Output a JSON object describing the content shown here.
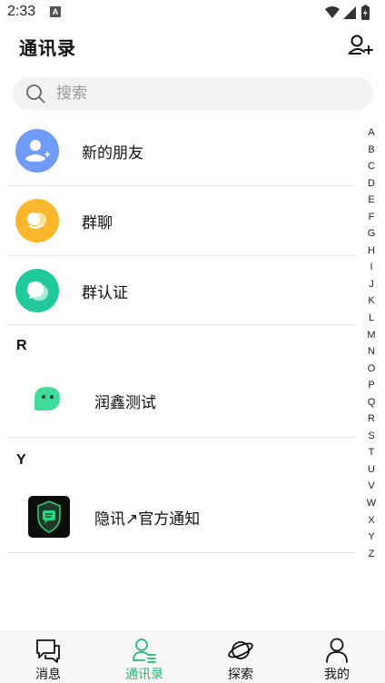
{
  "status_bar": {
    "time": "2:33",
    "notification_badge": "A"
  },
  "header": {
    "title": "通讯录",
    "add_friend_icon": "add-contact-icon"
  },
  "search": {
    "placeholder": "搜索"
  },
  "entries": [
    {
      "label": "新的朋友",
      "icon": "new-friend-icon",
      "color": "#6f9bfb"
    },
    {
      "label": "群聊",
      "icon": "group-chat-icon",
      "color": "#fbb72b"
    },
    {
      "label": "群认证",
      "icon": "group-verify-icon",
      "color": "#22c99a"
    }
  ],
  "sections": [
    {
      "letter": "R",
      "contacts": [
        {
          "name": "润鑫测试",
          "avatar": "green-chat-bubble-avatar",
          "color": "#3fdc9c"
        }
      ]
    },
    {
      "letter": "Y",
      "contacts": [
        {
          "name": "隐讯↗官方通知",
          "avatar": "shield-avatar",
          "color": "#1a1a1a"
        }
      ]
    }
  ],
  "index_letters": [
    "A",
    "B",
    "C",
    "D",
    "E",
    "F",
    "G",
    "H",
    "I",
    "J",
    "K",
    "L",
    "M",
    "N",
    "O",
    "P",
    "Q",
    "R",
    "S",
    "T",
    "U",
    "V",
    "W",
    "X",
    "Y",
    "Z"
  ],
  "tabs": [
    {
      "label": "消息",
      "icon": "message-icon",
      "active": false
    },
    {
      "label": "通讯录",
      "icon": "contacts-icon",
      "active": true
    },
    {
      "label": "探索",
      "icon": "planet-icon",
      "active": false
    },
    {
      "label": "我的",
      "icon": "profile-icon",
      "active": false
    }
  ],
  "colors": {
    "accent": "#2ab673",
    "search_bg": "#f2f2f2",
    "tabbar_bg": "#f7f7f7"
  }
}
